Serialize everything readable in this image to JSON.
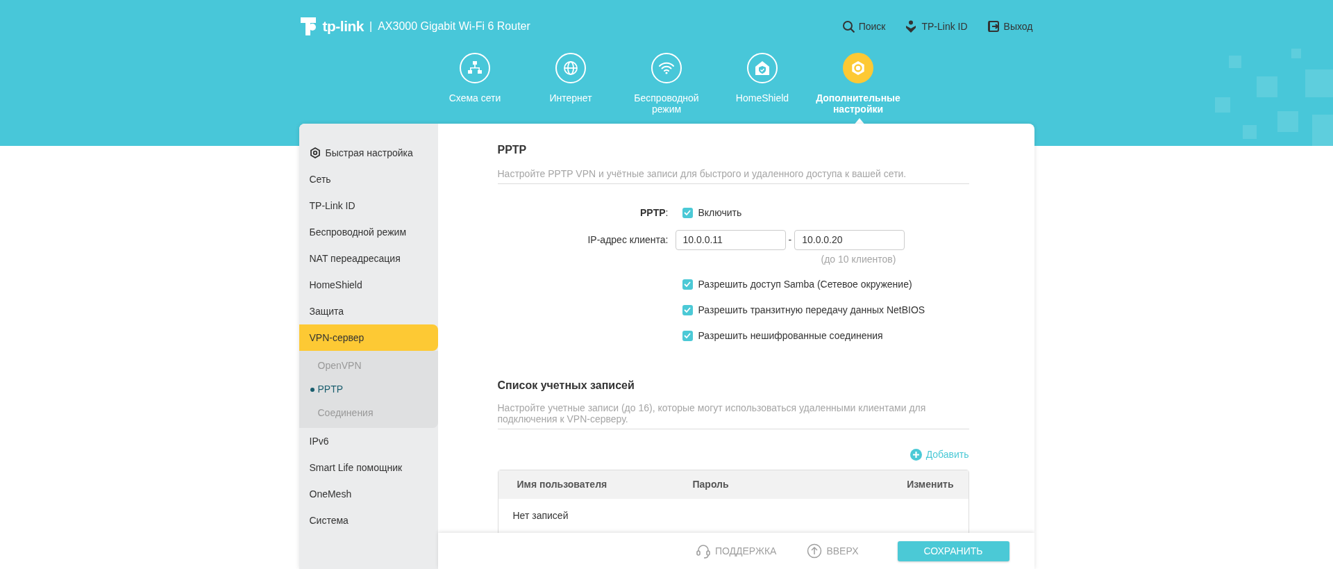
{
  "header": {
    "logo": "tp-link",
    "separator": "|",
    "model": "AX3000 Gigabit Wi-Fi 6 Router",
    "links": [
      {
        "label": "Поиск"
      },
      {
        "label": "TP-Link ID"
      },
      {
        "label": "Выход"
      }
    ]
  },
  "nav": [
    {
      "label": "Схема сети",
      "selected": false
    },
    {
      "label": "Интернет",
      "selected": false
    },
    {
      "label": "Беспроводной режим",
      "selected": false
    },
    {
      "label": "HomeShield",
      "selected": false
    },
    {
      "label": "Дополнительные настройки",
      "selected": true
    }
  ],
  "sidebar": {
    "items": [
      {
        "label": "Быстрая настройка",
        "kind": "quick",
        "selected": false
      },
      {
        "label": "Сеть",
        "selected": false
      },
      {
        "label": "TP-Link ID",
        "selected": false
      },
      {
        "label": "Беспроводной режим",
        "selected": false
      },
      {
        "label": "NAT переадресация",
        "selected": false
      },
      {
        "label": "HomeShield",
        "selected": false
      },
      {
        "label": "Защита",
        "selected": false
      },
      {
        "label": "VPN-сервер",
        "selected": true,
        "children": [
          {
            "label": "OpenVPN",
            "selected": false
          },
          {
            "label": "PPTP",
            "selected": true
          },
          {
            "label": "Соединения",
            "selected": false
          }
        ]
      },
      {
        "label": "IPv6",
        "selected": false
      },
      {
        "label": "Smart Life помощник",
        "selected": false
      },
      {
        "label": "OneMesh",
        "selected": false
      },
      {
        "label": "Система",
        "selected": false
      }
    ]
  },
  "pptp": {
    "title": "PPTP",
    "description": "Настройте PPTP VPN и учётные записи для быстрого и удаленного доступа к вашей сети.",
    "enable": {
      "label": "**PPTP**:",
      "text": "Включить",
      "checked": true
    },
    "client_ip": {
      "label": "IP-адрес клиента:",
      "start": "10.0.0.11",
      "dash": "-",
      "end": "10.0.0.20",
      "hint": "(до 10 клиентов)"
    },
    "options": [
      {
        "label": "Разрешить доступ Samba (Сетевое окружение)",
        "checked": true
      },
      {
        "label": "Разрешить транзитную передачу данных NetBIOS",
        "checked": true
      },
      {
        "label": "Разрешить нешифрованные соединения",
        "checked": true
      }
    ]
  },
  "accounts": {
    "title": "Список учетных записей",
    "description": "Настройте учетные записи (до 16), которые могут использоваться удаленными клиентами для подключения к VPN-серверу.",
    "add": "Добавить",
    "columns": [
      "Имя пользователя",
      "Пароль",
      "Изменить"
    ],
    "empty": "Нет записей"
  },
  "footer": {
    "support": "ПОДДЕРЖКА",
    "top": "ВВЕРХ",
    "save": "СОХРАНИТЬ"
  }
}
